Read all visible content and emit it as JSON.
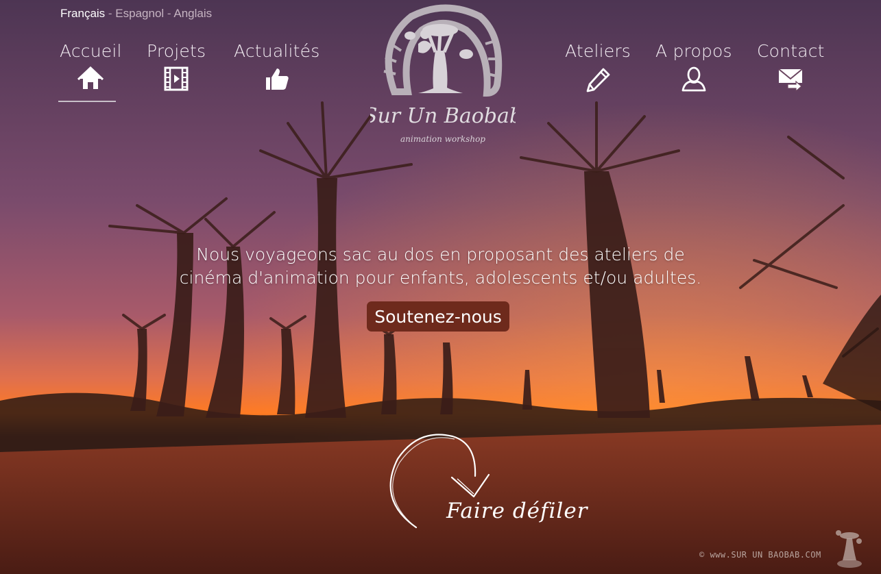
{
  "language_switcher": {
    "items": [
      "Français",
      "Espagnol",
      "Anglais"
    ],
    "separator": " - "
  },
  "nav": {
    "left": [
      {
        "label": "Accueil",
        "icon": "home-icon"
      },
      {
        "label": "Projets",
        "icon": "film-icon"
      },
      {
        "label": "Actualités",
        "icon": "thumbs-up-icon"
      }
    ],
    "right": [
      {
        "label": "Ateliers",
        "icon": "pencil-icon"
      },
      {
        "label": "A propos",
        "icon": "user-icon"
      },
      {
        "label": "Contact",
        "icon": "mail-forward-icon"
      }
    ]
  },
  "logo": {
    "title": "Sur Un Baobab",
    "subtitle": "animation workshop"
  },
  "hero": {
    "line1": "Nous voyageons sac au dos en proposant des ateliers de",
    "line2": "cinéma d'animation pour enfants, adolescents et/ou adultes.",
    "cta_label": "Soutenez-nous"
  },
  "scroll": {
    "label": "Faire défiler"
  },
  "footer": {
    "copyright": "© www.SUR UN BAOBAB.COM"
  },
  "colors": {
    "cta_bg": "#6e2a1c",
    "sky_top": "#5a3b5b",
    "sky_horizon": "#ff6a1a",
    "ground": "#7a2f1e"
  }
}
